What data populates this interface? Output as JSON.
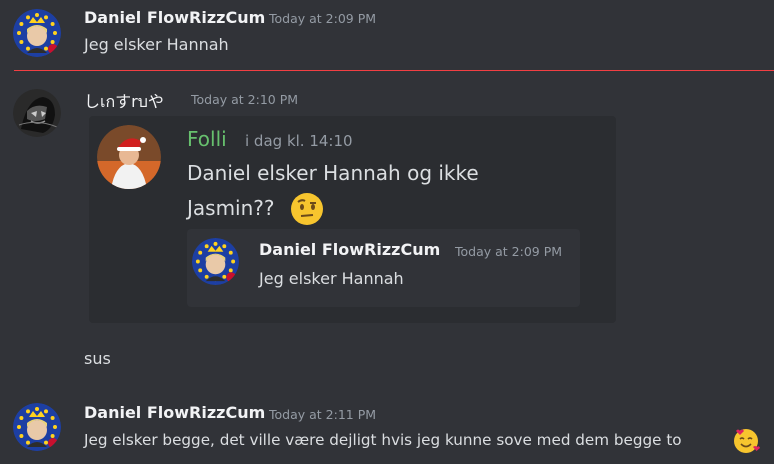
{
  "messages": [
    {
      "username": "Daniel FlowRizzCum",
      "timestamp": "Today at 2:09 PM",
      "text": "Jeg elsker Hannah"
    },
    {
      "username": "しเกすrบや",
      "timestamp": "Today at 2:10 PM"
    },
    {
      "text": "sus"
    },
    {
      "username": "Daniel FlowRizzCum",
      "timestamp": "Today at 2:11 PM",
      "text": "Jeg elsker begge, det ville være dejligt hvis jeg kunne sove med dem begge to"
    }
  ],
  "embed": {
    "author": "Folli",
    "timestamp": "i dag kl. 14:10",
    "text_line1": "Daniel elsker Hannah og ikke",
    "text_line2": "Jasmin??",
    "quote": {
      "username": "Daniel FlowRizzCum",
      "timestamp": "Today at 2:09 PM",
      "text": "Jeg elsker Hannah"
    }
  },
  "icons": {
    "eu_avatar": "eu-flag-avatar",
    "dark_avatar": "skull-avatar",
    "santa_avatar": "santa-avatar",
    "raised_eyebrow": "raised-eyebrow-emoji",
    "smiling_hearts": "smiling-hearts-emoji"
  },
  "colors": {
    "background": "#313338",
    "embed_bg": "#2b2d31",
    "new_divider": "#f23f43",
    "embed_author": "#67c06e",
    "username": "#f2f3f5",
    "timestamp": "#949ba4"
  }
}
